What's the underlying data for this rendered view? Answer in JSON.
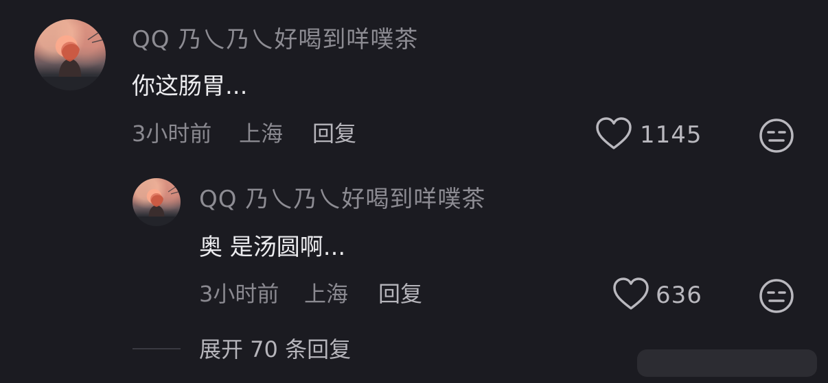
{
  "comments": [
    {
      "username": "QQ 乃乀乃乀好喝到咩噗茶",
      "text": "你这肠胃...",
      "time": "3小时前",
      "location": "上海",
      "reply_label": "回复",
      "likes": "1145",
      "like_icon": "heart-outline-icon",
      "emoji_icon": "neutral-face-icon"
    },
    {
      "username": "QQ 乃乀乃乀好喝到咩噗茶",
      "text": "奥 是汤圆啊...",
      "time": "3小时前",
      "location": "上海",
      "reply_label": "回复",
      "likes": "636",
      "like_icon": "heart-outline-icon",
      "emoji_icon": "neutral-face-icon"
    }
  ],
  "expand_replies": {
    "label": "展开 70 条回复"
  },
  "colors": {
    "background": "#1b1b21",
    "username": "#8d8c93",
    "text": "#ececef",
    "meta": "#8a8990",
    "action": "#b6b5bb"
  }
}
